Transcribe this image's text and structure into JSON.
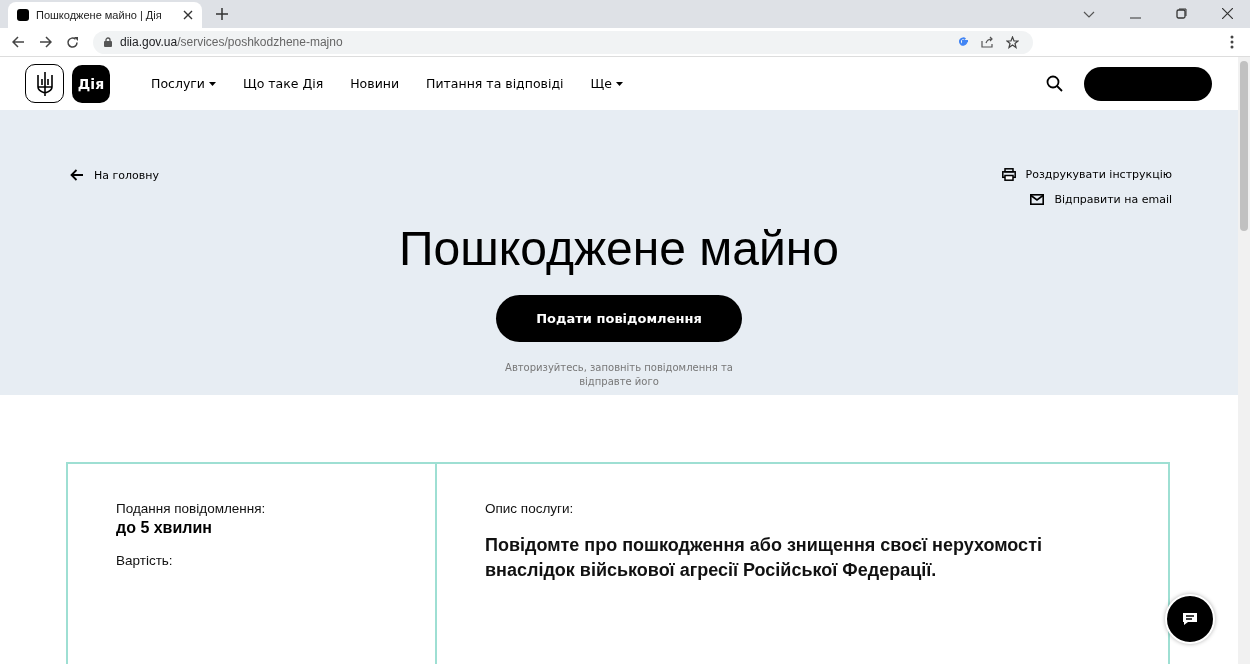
{
  "browser": {
    "tab_title": "Пошкоджене майно | Дія",
    "url_host": "diia.gov.ua",
    "url_path": "/services/poshkodzhene-majno"
  },
  "header": {
    "logo_text": "Дія",
    "nav": [
      {
        "label": "Послуги",
        "dropdown": true
      },
      {
        "label": "Що таке Дія",
        "dropdown": false
      },
      {
        "label": "Новини",
        "dropdown": false
      },
      {
        "label": "Питання та відповіді",
        "dropdown": false
      },
      {
        "label": "Ще",
        "dropdown": true
      }
    ]
  },
  "hero": {
    "back_link": "На головну",
    "actions": [
      {
        "kind": "print",
        "label": "Роздрукувати інструкцію"
      },
      {
        "kind": "email",
        "label": "Відправити на email"
      }
    ],
    "title": "Пошкоджене майно",
    "button": "Подати повідомлення",
    "hint": "Авторизуйтесь, заповніть повідомлення та відправте його"
  },
  "info": {
    "facts": [
      {
        "label": "Подання повідомлення:",
        "value": "до 5 хвилин"
      },
      {
        "label": "Вартість:"
      }
    ],
    "description_label": "Опис послуги:",
    "description": "Повідомте про пошкодження або знищення своєї нерухомості внаслідок військової агресії Російської Федерації."
  }
}
